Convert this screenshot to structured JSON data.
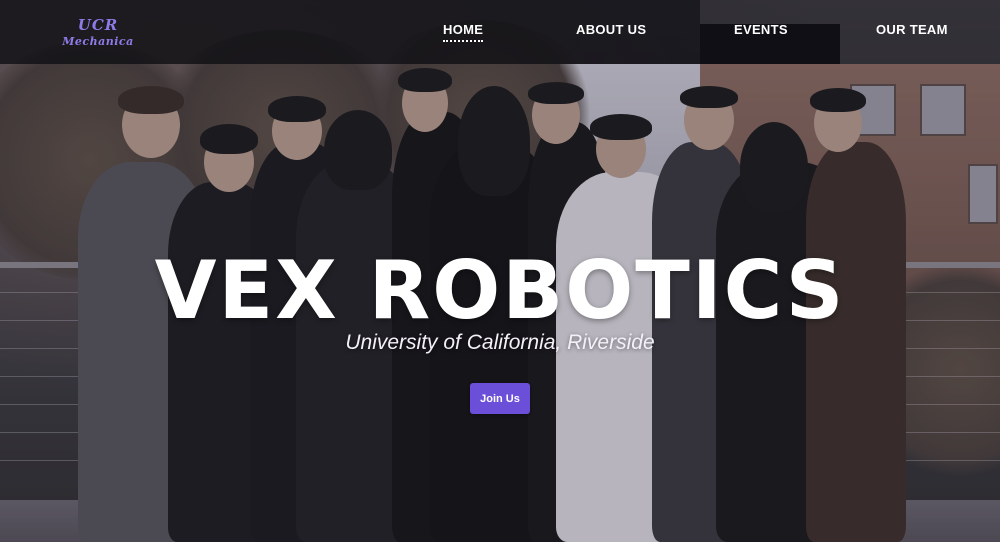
{
  "logo": {
    "line1": "UCR",
    "line2": "Mechanica"
  },
  "nav": {
    "items": [
      {
        "label": "HOME",
        "active": true
      },
      {
        "label": "ABOUT US",
        "active": false
      },
      {
        "label": "EVENTS",
        "active": false
      },
      {
        "label": "OUR TEAM",
        "active": false
      }
    ]
  },
  "hero": {
    "title": "VEX ROBOTICS",
    "subtitle": "University of California, Riverside",
    "cta_label": "Join Us"
  },
  "colors": {
    "accent": "#6b4fd8",
    "logo": "#8d7be8",
    "nav_text": "#ffffff"
  }
}
